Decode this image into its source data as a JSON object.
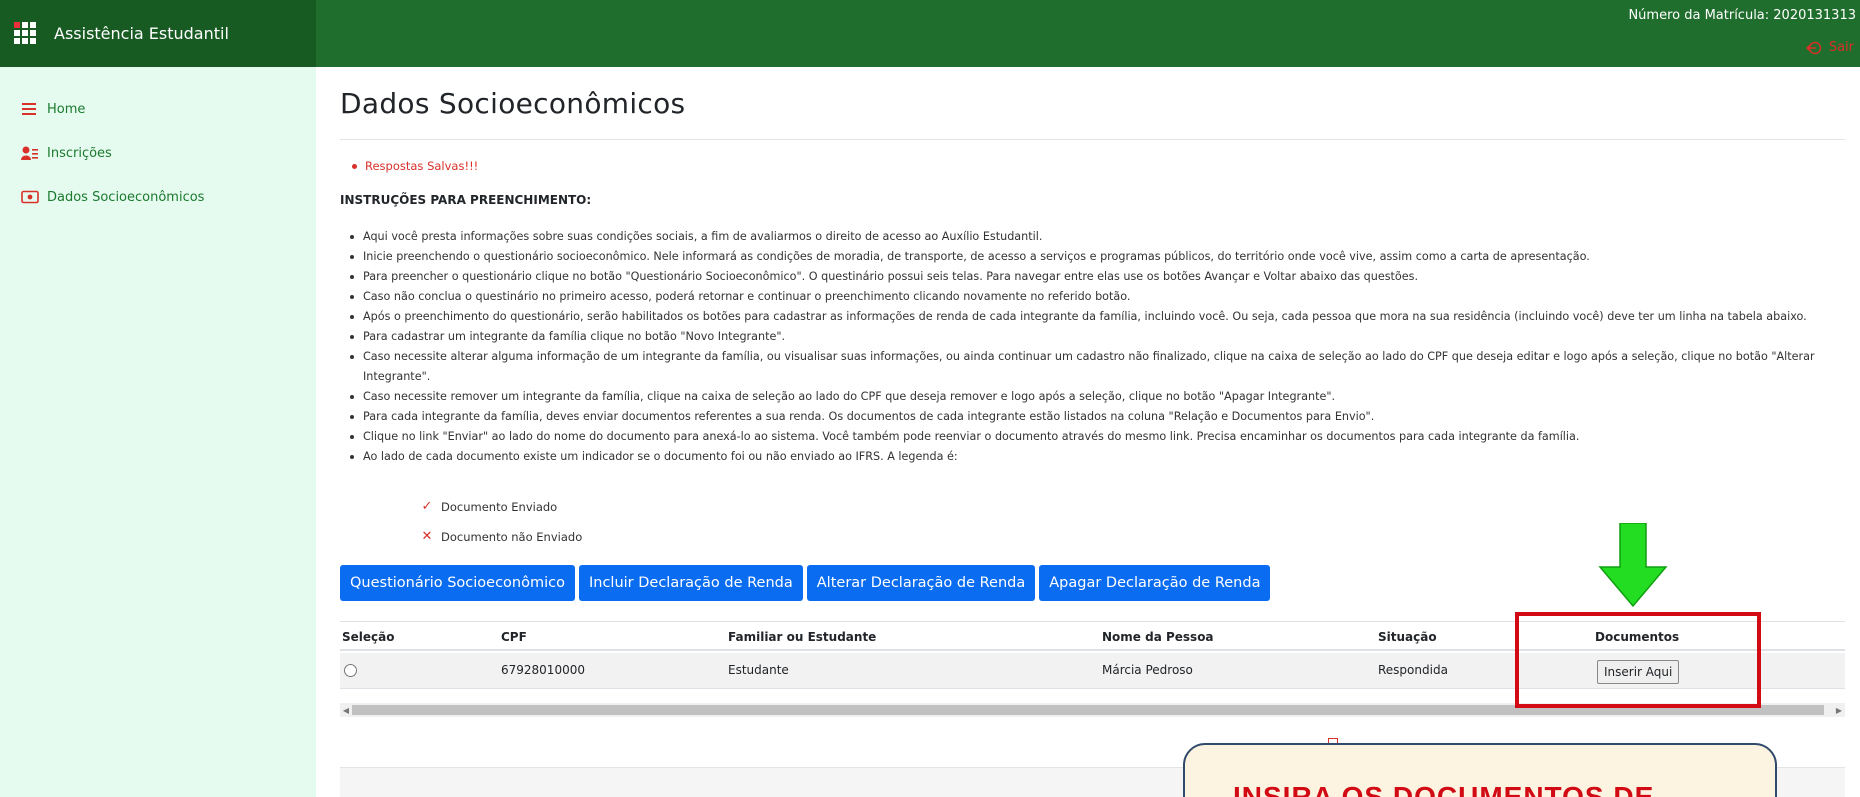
{
  "header": {
    "app_title": "Assistência Estudantil",
    "matricula": "Número da Matrícula: 2020131313",
    "logout_label": "Sair"
  },
  "sidebar": {
    "items": [
      {
        "label": "Home",
        "icon": "list-icon"
      },
      {
        "label": "Inscrições",
        "icon": "user-list-icon"
      },
      {
        "label": "Dados Socioeconômicos",
        "icon": "id-card-icon"
      }
    ]
  },
  "main": {
    "title": "Dados Socioeconômicos",
    "saved_message": "Respostas Salvas!!!",
    "instructions_heading": "INSTRUÇÕES PARA PREENCHIMENTO:",
    "instructions": [
      "Aqui você presta informações sobre suas condições sociais, a fim de avaliarmos o direito de acesso ao Auxílio Estudantil.",
      "Inicie preenchendo o questionário socioeconômico. Nele informará as condições de moradia, de transporte, de acesso a serviços e programas públicos, do território onde você vive, assim como a carta de apresentação.",
      "Para preencher o questionário clique no botão \"Questionário Socioeconômico\". O questinário possui seis telas. Para navegar entre elas use os botões Avançar e Voltar abaixo das questões.",
      "Caso não conclua o questinário no primeiro acesso, poderá retornar e continuar o preenchimento clicando novamente no referido botão.",
      "Após o preenchimento do questionário, serão habilitados os botões para cadastrar as informações de renda de cada integrante da família, incluindo você. Ou seja, cada pessoa que mora na sua residência (incluindo você) deve ter um linha na tabela abaixo.",
      "Para cadastrar um integrante da família clique no botão \"Novo Integrante\".",
      "Caso necessite alterar alguma informação de um integrante da família, ou visualisar suas informações, ou ainda continuar um cadastro não finalizado, clique na caixa de seleção ao lado do CPF que deseja editar e logo após a seleção, clique no botão \"Alterar Integrante\".",
      "Caso necessite remover um integrante da família, clique na caixa de seleção ao lado do CPF que deseja remover e logo após a seleção, clique no botão \"Apagar Integrante\".",
      "Para cada integrante da família, deves enviar documentos referentes a sua renda. Os documentos de cada integrante estão listados na coluna \"Relação e Documentos para Envio\".",
      "Clique no link \"Enviar\" ao lado do nome do documento para anexá-lo ao sistema. Você também pode reenviar o documento através do mesmo link. Precisa encaminhar os documentos para cada integrante da família.",
      "Ao lado de cada documento existe um indicador se o documento foi ou não enviado ao IFRS. A legenda é:"
    ],
    "legend": [
      {
        "mark": "✓",
        "label": "Documento Enviado"
      },
      {
        "mark": "✕",
        "label": "Documento não Enviado"
      }
    ],
    "buttons": [
      "Questionário Socioeconômico",
      "Incluir Declaração de Renda",
      "Alterar Declaração de Renda",
      "Apagar Declaração de Renda"
    ],
    "table": {
      "headers": [
        "Seleção",
        "CPF",
        "Familiar ou Estudante",
        "Nome da Pessoa",
        "Situação",
        "Documentos"
      ],
      "rows": [
        {
          "cpf": "67928010000",
          "tipo": "Estudante",
          "nome": "Márcia Pedroso",
          "situacao": "Respondida",
          "documentos_button": "Inserir Aqui"
        }
      ]
    }
  },
  "annotation": {
    "callout_text": "INSIRA OS DOCUMENTOS DE",
    "highlight_color": "#d10a14",
    "arrow_color": "#22dd22"
  },
  "colors": {
    "header_green": "#1f6e2d",
    "brand_green": "#175b23",
    "sidebar_bg": "#e6fbef",
    "link_green": "#1a7a2e",
    "primary_blue": "#0a6cf0",
    "alert_red": "#d9302a"
  }
}
